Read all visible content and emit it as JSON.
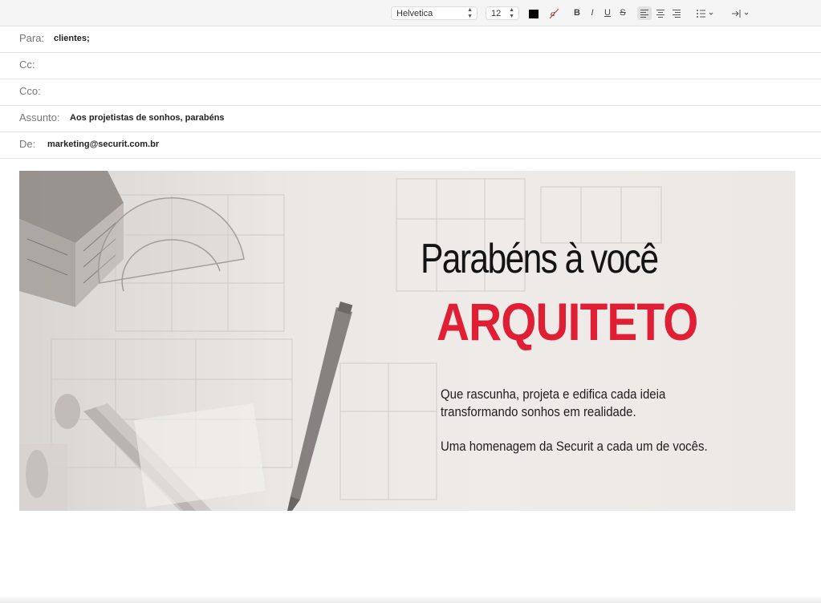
{
  "toolbar": {
    "font_name": "Helvetica",
    "font_size": "12",
    "text_color": "#000000",
    "bold_label": "B",
    "italic_label": "I",
    "underline_label": "U",
    "strike_label": "S",
    "list_icon": "list-icon",
    "indent_icon": "indent-icon"
  },
  "headers": {
    "to": {
      "label": "Para:",
      "value": "clientes;"
    },
    "cc": {
      "label": "Cc:",
      "value": ""
    },
    "bcc": {
      "label": "Cco:",
      "value": ""
    },
    "subject": {
      "label": "Assunto:",
      "value": "Aos projetistas de sonhos, parabéns"
    },
    "from": {
      "label": "De:",
      "value": "marketing@securit.com.br"
    }
  },
  "banner": {
    "headline": "Parabéns à você",
    "headline_accent": "ARQUITETO",
    "accent_color": "#e01e34",
    "body1": "Que rascunha, projeta e edifica cada ideia transformando sonhos em realidade.",
    "body2": "Uma homenagem da Securit a cada um de vocês."
  }
}
